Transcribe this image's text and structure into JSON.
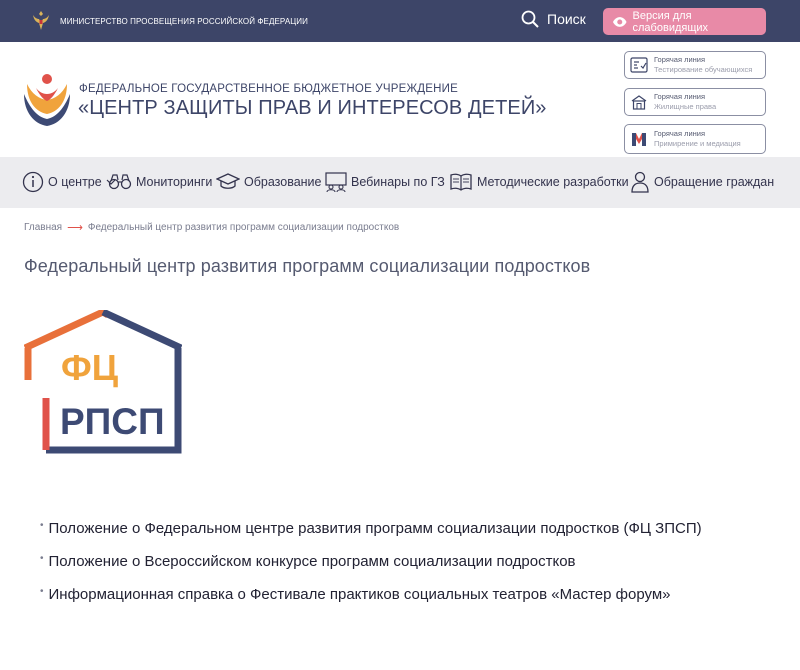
{
  "topbar": {
    "ministry_label": "МИНИСТЕРСТВО ПРОСВЕЩЕНИЯ РОССИЙСКОЙ ФЕДЕРАЦИИ",
    "search_label": "Поиск",
    "vision_label": "Версия для слабовидящих"
  },
  "header": {
    "org_subtitle": "ФЕДЕРАЛЬНОЕ ГОСУДАРСТВЕННОЕ БЮДЖЕТНОЕ УЧРЕЖДЕНИЕ",
    "org_title": "«ЦЕНТР ЗАЩИТЫ ПРАВ И ИНТЕРЕСОВ ДЕТЕЙ»",
    "hotlines": [
      {
        "title": "Горячая линия",
        "subtitle": "Тестирование обучающихся",
        "icon": "test-form-icon"
      },
      {
        "title": "Горячая линия",
        "subtitle": "Жилищные права",
        "icon": "house-icon"
      },
      {
        "title": "Горячая линия",
        "subtitle": "Примирение и медиация",
        "icon": "mediation-m-icon"
      }
    ]
  },
  "nav": {
    "items": [
      {
        "label": "О центре",
        "icon": "info-icon"
      },
      {
        "label": "Мониторинги",
        "icon": "binoculars-icon"
      },
      {
        "label": "Образование",
        "icon": "graduation-cap-icon"
      },
      {
        "label": "Вебинары по ГЗ",
        "icon": "webinar-icon"
      },
      {
        "label": "Методические разработки",
        "icon": "book-icon"
      },
      {
        "label": "Обращение граждан",
        "icon": "person-icon"
      }
    ]
  },
  "breadcrumb": {
    "home": "Главная",
    "current": "Федеральный центр развития программ социализации подростков"
  },
  "page": {
    "title": "Федеральный центр развития программ социализации подростков",
    "logo_text_top": "ФЦ",
    "logo_text_bottom": "РПСП"
  },
  "documents": [
    "Положение о Федеральном центре развития программ социализации подростков (ФЦ ЗПСП)",
    "Положение о Всероссийском конкурсе программ социализации подростков",
    "Информационная справка о Фестивале практиков социальных театров «Мастер форум»"
  ],
  "colors": {
    "topbar": "#3d4568",
    "vision_button": "#e88aa7",
    "nav_background": "#ececef",
    "accent_red": "#e0524a",
    "logo_orange": "#f0a33c",
    "logo_navy": "#3d4a74"
  }
}
